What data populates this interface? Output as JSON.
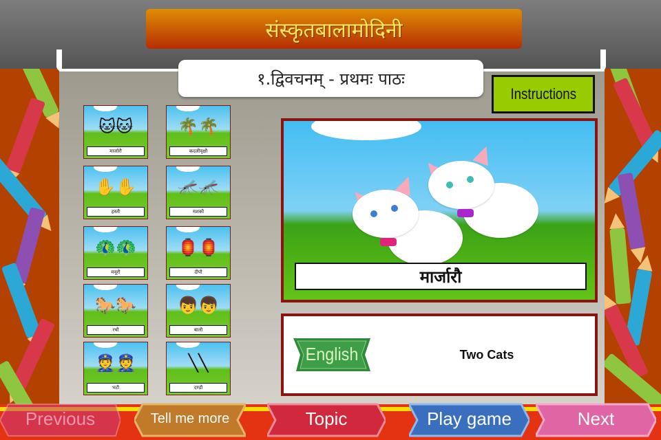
{
  "app": {
    "title": "संस्कृतबालामोदिनी",
    "lesson_title": "१.द्विवचनम् - प्रथमः पाठः"
  },
  "instructions_label": "Instructions",
  "thumbnails": [
    {
      "label": "मार्जारौ",
      "icon": "cats-icon",
      "glyph": "🐱🐱"
    },
    {
      "label": "कदलीवृक्षौ",
      "icon": "banana-trees-icon",
      "glyph": "🌴🌴"
    },
    {
      "label": "हस्तौ",
      "icon": "hands-icon",
      "glyph": "✋✋"
    },
    {
      "label": "मशकौ",
      "icon": "mosquitoes-icon",
      "glyph": "🦟🦟"
    },
    {
      "label": "मयूरौ",
      "icon": "peacocks-icon",
      "glyph": "🦚🦚"
    },
    {
      "label": "दीपौ",
      "icon": "lanterns-icon",
      "glyph": "🏮🏮"
    },
    {
      "label": "रथौ",
      "icon": "chariots-icon",
      "glyph": "🐎🐎"
    },
    {
      "label": "बालौ",
      "icon": "boys-icon",
      "glyph": "👦👦"
    },
    {
      "label": "भटौ",
      "icon": "policemen-icon",
      "glyph": "👮👮"
    },
    {
      "label": "दण्डौ",
      "icon": "sticks-icon",
      "glyph": "╲╲"
    }
  ],
  "selected": {
    "word": "मार्जारौ",
    "image": "two-cats-illustration",
    "language_label": "English",
    "meaning": "Two Cats"
  },
  "nav": {
    "previous": "Previous",
    "tell_me_more": "Tell me more",
    "topic": "Topic",
    "play_game": "Play game",
    "next": "Next"
  },
  "colors": {
    "title_text": "#ffe75a",
    "instructions_bg": "#99cc00",
    "frame_border": "#8a1410",
    "nav_bar": "#e33312",
    "tell_me_more": "#c07a2a",
    "topic": "#d0283c",
    "play_game": "#3a6fc0",
    "next": "#e065a4"
  }
}
